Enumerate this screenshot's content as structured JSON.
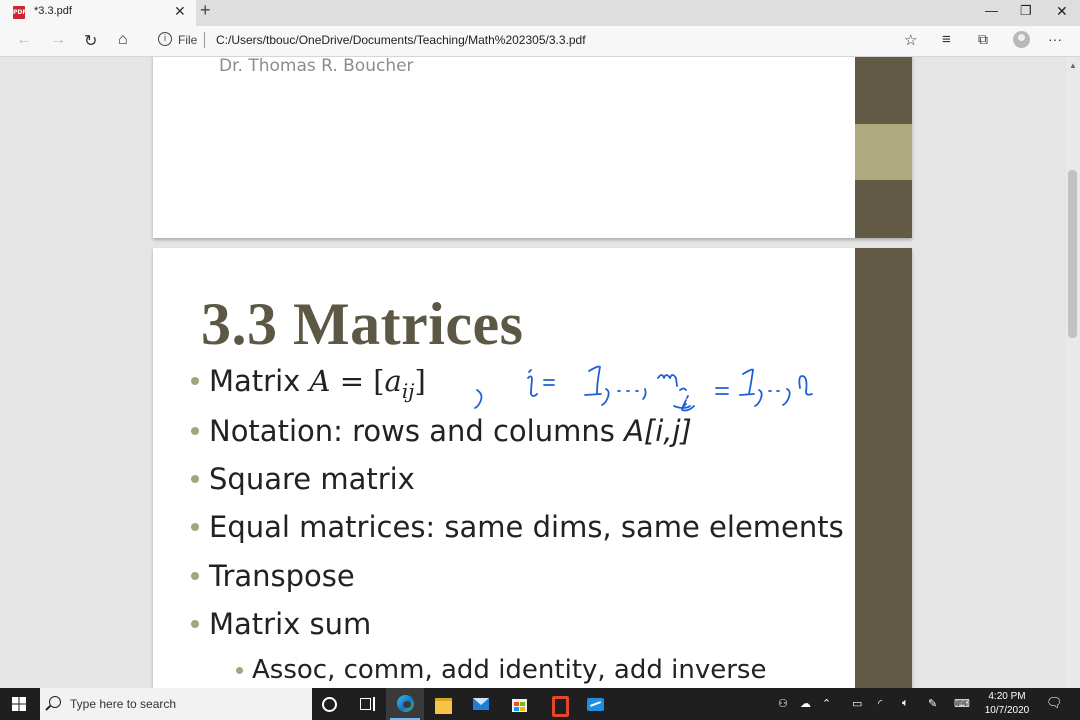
{
  "browser": {
    "tab_title": "*3.3.pdf",
    "tab_icon": "PDF",
    "file_label": "File",
    "url": "C:/Users/tbouc/OneDrive/Documents/Teaching/Math%202305/3.3.pdf"
  },
  "pdf": {
    "page1": {
      "author": "Dr. Thomas R. Boucher"
    },
    "page2": {
      "title": "3.3 Matrices",
      "bullets": {
        "matrix_prefix": "Matrix ",
        "matrix_A": "A",
        "matrix_eq": " = [",
        "matrix_a": "a",
        "matrix_sub": "ij",
        "matrix_close": "]",
        "notation_text": "Notation: rows and columns ",
        "notation_math": "A[i,j]",
        "square": "Square matrix",
        "equal": "Equal matrices: same dims, same elements",
        "transpose": "Transpose",
        "sum": "Matrix sum",
        "sub_assoc": "Assoc, comm, add identity, add inverse"
      },
      "colors": {
        "title": "#5c5845",
        "sidebar": "#625a44",
        "sidebar_highlight": "#aea97f",
        "bullet": "#a5a27e",
        "ink": "#1f5fd6"
      }
    }
  },
  "taskbar": {
    "search_placeholder": "Type here to search",
    "time": "4:20 PM",
    "date": "10/7/2020"
  }
}
